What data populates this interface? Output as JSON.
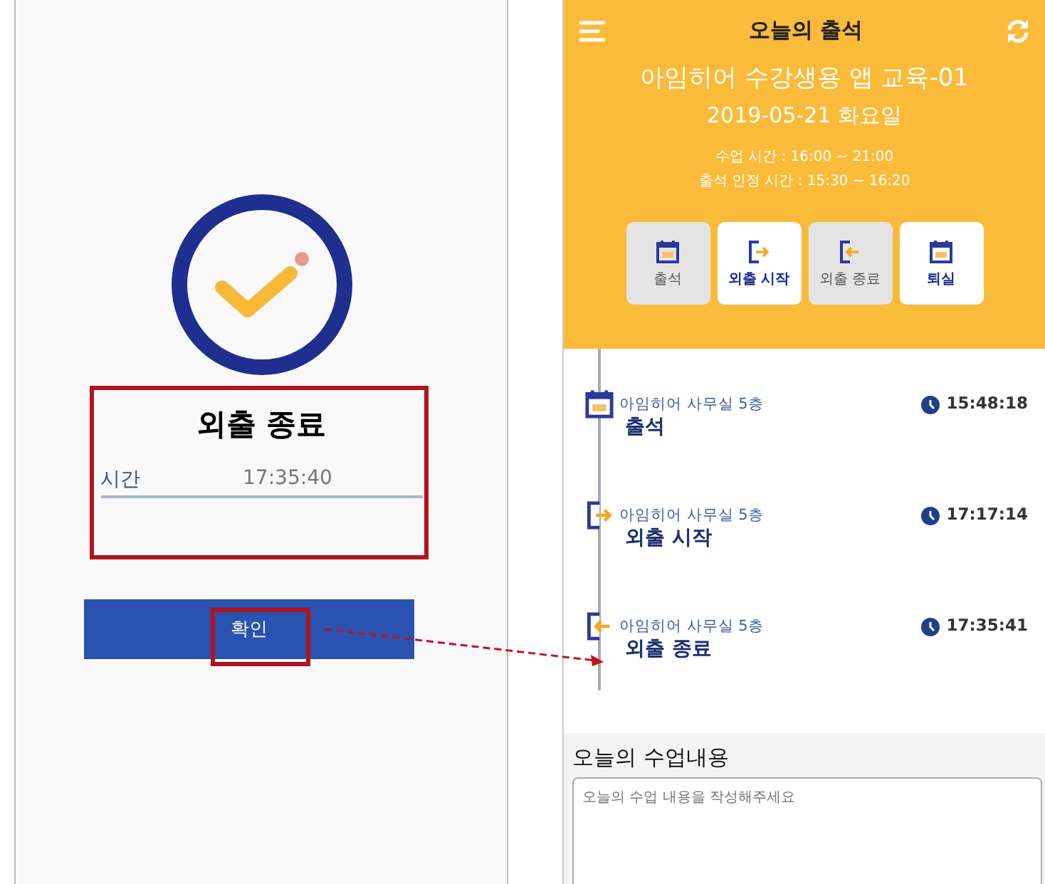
{
  "dialog": {
    "title": "외출 종료",
    "time_label": "시간",
    "time_value": "17:35:40",
    "confirm_button": "확인"
  },
  "app": {
    "title": "오늘의 출석",
    "course": "아임히어 수강생용 앱 교육-01",
    "date": "2019-05-21 화요일",
    "class_time": "수업 시간 : 16:00 ~ 21:00",
    "attendance_window": "출석 인정 시간 : 15:30 ~ 16:20",
    "actions": [
      {
        "label": "출석",
        "kind": "calendar",
        "disabled": true
      },
      {
        "label": "외출 시작",
        "kind": "exit",
        "disabled": false
      },
      {
        "label": "외출 종료",
        "kind": "return",
        "disabled": true
      },
      {
        "label": "퇴실",
        "kind": "calendar",
        "disabled": false
      }
    ],
    "timeline": [
      {
        "kind": "calendar",
        "place": "아임히어 사무실 5층",
        "event": "출석",
        "time": "15:48:18"
      },
      {
        "kind": "exit",
        "place": "아임히어 사무실 5층",
        "event": "외출 시작",
        "time": "17:17:14"
      },
      {
        "kind": "return",
        "place": "아임히어 사무실 5층",
        "event": "외출 종료",
        "time": "17:35:41"
      }
    ],
    "notes": {
      "heading": "오늘의 수업내용",
      "placeholder": "오늘의 수업 내용을 작성해주세요"
    }
  }
}
